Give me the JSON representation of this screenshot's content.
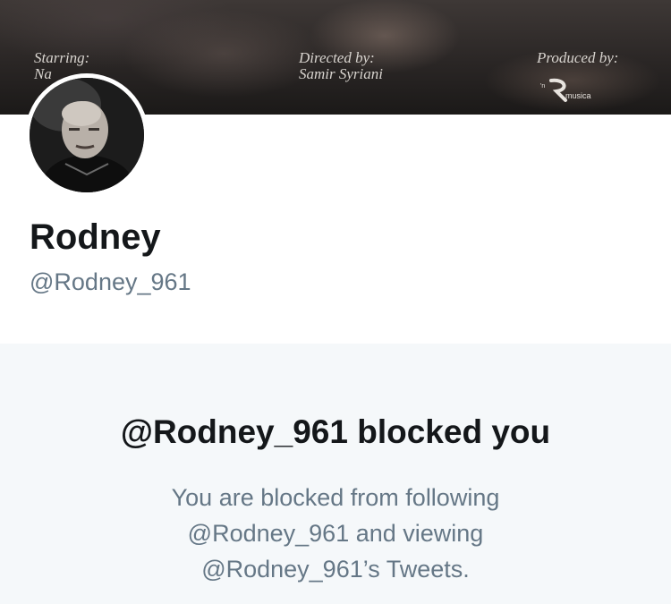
{
  "banner": {
    "starring_label": "Starring:",
    "starring_value": "Na",
    "directed_label": "Directed by:",
    "directed_value": "Samir Syriani",
    "produced_label": "Produced by:",
    "producer_logo_text": "musica"
  },
  "profile": {
    "display_name": "Rodney",
    "handle": "@Rodney_961"
  },
  "blocked": {
    "title": "@Rodney_961 blocked you",
    "line1": "You are blocked from following",
    "line2": "@Rodney_961 and viewing",
    "line3": "@Rodney_961’s Tweets."
  }
}
